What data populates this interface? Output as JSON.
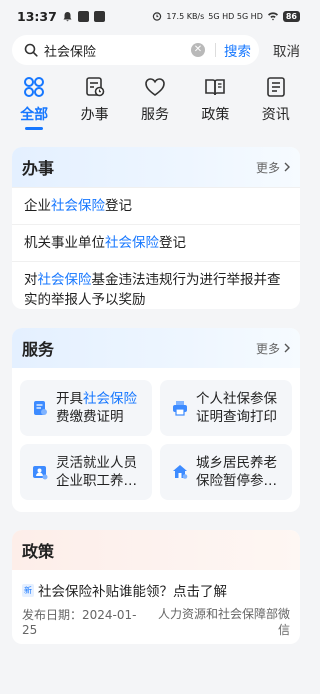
{
  "status_bar": {
    "time": "13:37",
    "net_speed": "17.5 KB/s",
    "signal": "5G HD 5G HD",
    "battery": "86"
  },
  "search": {
    "query": "社会保险",
    "search_label": "搜索",
    "cancel_label": "取消"
  },
  "tabs": [
    {
      "label": "全部",
      "icon": "grid-icon",
      "active": true
    },
    {
      "label": "办事",
      "icon": "task-icon",
      "active": false
    },
    {
      "label": "服务",
      "icon": "heart-icon",
      "active": false
    },
    {
      "label": "政策",
      "icon": "policy-book-icon",
      "active": false
    },
    {
      "label": "资讯",
      "icon": "news-icon",
      "active": false
    }
  ],
  "affairs": {
    "title": "办事",
    "more": "更多",
    "items": [
      {
        "pre": "企业",
        "hl": "社会保险",
        "post": "登记"
      },
      {
        "pre": "机关事业单位",
        "hl": "社会保险",
        "post": "登记"
      },
      {
        "pre": "对",
        "hl": "社会保险",
        "post": "基金违法违规行为进行举报并查实的举报人予以奖励"
      }
    ]
  },
  "services": {
    "title": "服务",
    "more": "更多",
    "items": [
      {
        "line1_pre": "开具",
        "line1_hl": "社会保险",
        "line2": "费缴费证明",
        "icon": "document-icon"
      },
      {
        "line1_pre": "个人社保参保",
        "line1_hl": "",
        "line2": "证明查询打印",
        "icon": "printer-icon"
      },
      {
        "line1_pre": "灵活就业人员",
        "line1_hl": "",
        "line2": "企业职工养…",
        "icon": "person-card-icon"
      },
      {
        "line1_pre": "城乡居民养老",
        "line1_hl": "",
        "line2": "保险暂停参…",
        "icon": "house-icon"
      }
    ]
  },
  "policy": {
    "title": "政策",
    "badge": "新",
    "news_title": "社会保险补贴谁能领？点击了解",
    "date": "发布日期：2024-01-25",
    "source": "人力资源和社会保障部微信"
  },
  "colors": {
    "accent": "#1677ff"
  }
}
